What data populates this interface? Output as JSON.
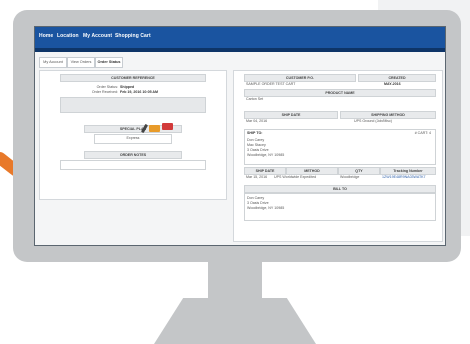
{
  "nav": {
    "home": "Home",
    "location": "Location",
    "account": "My Account",
    "shopping_cart": "Shopping Cart"
  },
  "tabs": [
    "My Account",
    "View Orders",
    "Order Status"
  ],
  "left": {
    "section1_header": "CUSTOMER REFERENCE",
    "order_status_label": "Order Status:",
    "order_status_value": "Shipped",
    "order_received_label": "Order Received:",
    "order_received_value": "Feb 19, 2016 10:05 AM",
    "section2_header": "SPECIAL PLAN",
    "plan_value": "Express",
    "section3_header": "ORDER NOTES"
  },
  "right": {
    "customer_po_header": "CUSTOMER P.O.",
    "created_header": "CREATED",
    "customer_po_value": "SAMPLE ORDER TEST CART",
    "created_value": "MAY-2016",
    "product_name_header": "PRODUCT NAME",
    "product_name_value": "Carton Set",
    "ship_date_header": "SHIP DATE",
    "shipping_method_header": "SHIPPING METHOD",
    "ship_date_value": "Mar 04, 2016",
    "shipping_method_value": "UPS Ground (Job/Misc)",
    "ship_to_label": "SHIP TO:",
    "cart_label": "# CART: 4",
    "ship_to_lines": [
      "Don Carey",
      "Mac Stacey",
      "3 Oasis Drive",
      "Woodbridge, NY 10985"
    ],
    "ship_date2_header": "SHIP DATE",
    "method_header": "METHOD",
    "qty_header": "QTY",
    "tracking_header": "Tracking Number",
    "row_ship_date": "Mar 15, 2016",
    "row_method": "UPS Worldwide Expedited",
    "row_qty": "Woodbridge",
    "row_tracking": "1ZW19E48R9NA03WATK7",
    "bill_to_header": "BILL TO",
    "bill_to_lines": [
      "Don Carey",
      "3 Oasis Drive",
      "Woodbridge, NY 10985"
    ]
  },
  "colors": {
    "accent": "#1a54a0",
    "cable": "#e8792a",
    "bezel": "#c4c6c8"
  }
}
